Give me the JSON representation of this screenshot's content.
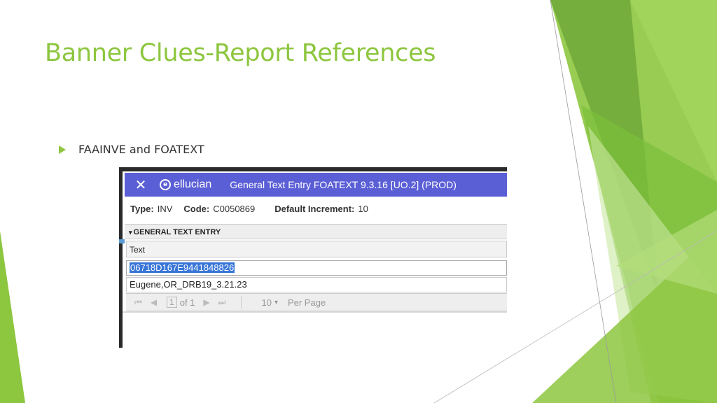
{
  "slide": {
    "title": "Banner Clues-Report References",
    "bullet": "FAAINVE and FOATEXT"
  },
  "app": {
    "close_symbol": "✕",
    "logo_symbol": "e",
    "logo_text": "ellucian",
    "window_title": "General Text Entry FOATEXT 9.3.16 [UO.2] (PROD)"
  },
  "key_block": {
    "type_label": "Type:",
    "type_value": "INV",
    "code_label": "Code:",
    "code_value": "C0050869",
    "increment_label": "Default Increment:",
    "increment_value": "10"
  },
  "section": {
    "indicator": "▾",
    "title": "GENERAL TEXT ENTRY"
  },
  "grid": {
    "column_header": "Text",
    "rows": [
      "06718D167E9441848826",
      "Eugene,OR_DRB19_3.21.23"
    ]
  },
  "pager": {
    "first": "⏮",
    "prev": "◀",
    "page": "1",
    "of_text": "of 1",
    "next": "▶",
    "last": "⏭",
    "page_size": "10",
    "per_page_label": "Per Page"
  },
  "colors": {
    "accent_green": "#8dc63f",
    "header_blue": "#5b5fd6",
    "selection_blue": "#3875d7"
  }
}
